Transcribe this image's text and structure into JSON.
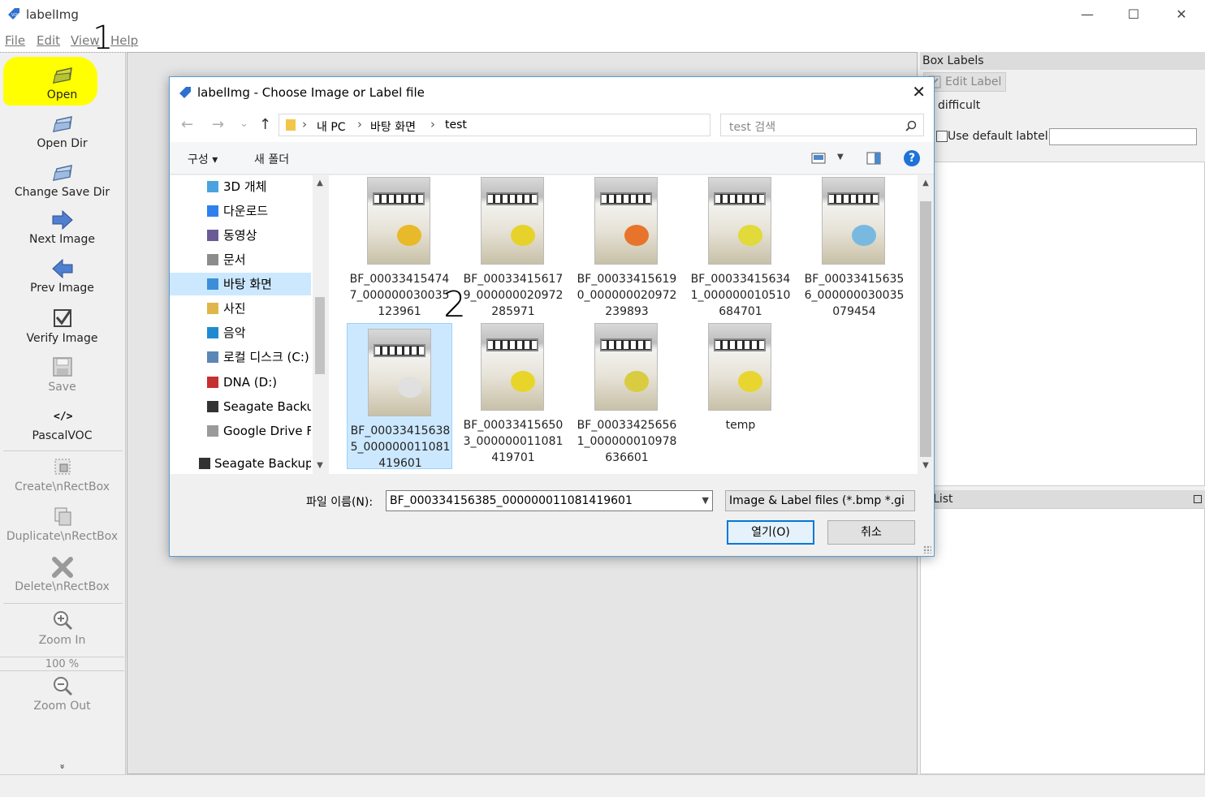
{
  "app": {
    "title": "labelImg",
    "icon": "labelimg-app-icon"
  },
  "window_controls": {
    "minimize": "—",
    "maximize": "☐",
    "close": "✕"
  },
  "menu": [
    {
      "label": "File"
    },
    {
      "label": "Edit"
    },
    {
      "label": "View"
    },
    {
      "label": "Help"
    }
  ],
  "annotations": {
    "step1": "1",
    "step2": "2",
    "highlight_color": "#ffff00"
  },
  "toolbar": {
    "items": [
      {
        "label": "Open",
        "icon": "open-folder-icon",
        "enabled": true
      },
      {
        "label": "Open Dir",
        "icon": "open-dir-icon",
        "enabled": true
      },
      {
        "label": "Change Save Dir",
        "icon": "change-save-dir-icon",
        "enabled": true
      },
      {
        "label": "Next Image",
        "icon": "next-arrow-icon",
        "enabled": true
      },
      {
        "label": "Prev Image",
        "icon": "prev-arrow-icon",
        "enabled": true
      },
      {
        "label": "Verify Image",
        "icon": "verify-check-icon",
        "enabled": true
      },
      {
        "label": "Save",
        "icon": "save-disk-icon",
        "enabled": false
      },
      {
        "label": "PascalVOC",
        "icon": "code-tag-icon",
        "enabled": true
      },
      {
        "label": "Create\\nRectBox",
        "icon": "create-rectbox-icon",
        "enabled": false
      },
      {
        "label": "Duplicate\\nRectBox",
        "icon": "duplicate-rectbox-icon",
        "enabled": false
      },
      {
        "label": "Delete\\nRectBox",
        "icon": "delete-rectbox-icon",
        "enabled": false
      },
      {
        "label": "Zoom In",
        "icon": "zoom-in-icon",
        "enabled": false
      },
      {
        "label": "Zoom Out",
        "icon": "zoom-out-icon",
        "enabled": false
      }
    ],
    "zoom_value": "100 %",
    "expand_glyph": "»"
  },
  "dock": {
    "box_labels_title": "Box Labels",
    "edit_label": "Edit Label",
    "difficult": "difficult",
    "use_default_label": "Use default labtel",
    "default_label_value": "",
    "file_list_title": "e List"
  },
  "dialog": {
    "title": "labelImg - Choose Image or Label file",
    "nav": {
      "back": "←",
      "forward": "→",
      "recent": "⌄",
      "up": "↑"
    },
    "breadcrumb": [
      "내 PC",
      "바탕 화면",
      "test"
    ],
    "refresh_glyph": "↻",
    "search_placeholder": "test 검색",
    "commands": {
      "organize": "구성 ▾",
      "new_folder": "새 폴더"
    },
    "help_glyph": "?",
    "nav_items": [
      {
        "label": "3D 개체",
        "icon": "3d-objects-icon",
        "color": "#4aa3df"
      },
      {
        "label": "다운로드",
        "icon": "downloads-icon",
        "color": "#2f80ed"
      },
      {
        "label": "동영상",
        "icon": "videos-icon",
        "color": "#6b5b95"
      },
      {
        "label": "문서",
        "icon": "documents-icon",
        "color": "#8c8c8c"
      },
      {
        "label": "바탕 화면",
        "icon": "desktop-icon",
        "color": "#3b8fd9",
        "selected": true
      },
      {
        "label": "사진",
        "icon": "pictures-icon",
        "color": "#e0b64a"
      },
      {
        "label": "음악",
        "icon": "music-icon",
        "color": "#1f8ad2"
      },
      {
        "label": "로컬 디스크 (C:)",
        "icon": "local-disk-icon",
        "color": "#5b87b5"
      },
      {
        "label": "DNA (D:)",
        "icon": "usb-drive-icon",
        "color": "#c53030"
      },
      {
        "label": "Seagate Backup",
        "icon": "external-drive-icon",
        "color": "#333333"
      },
      {
        "label": "Google Drive Fil",
        "icon": "google-drive-icon",
        "color": "#9a9a9a"
      },
      {
        "label": "Seagate Backup P",
        "icon": "external-drive-icon",
        "color": "#333333"
      }
    ],
    "files": [
      {
        "name": "BF_000334154747_000000030035123961",
        "sticker": "#e8b928"
      },
      {
        "name": "BF_000334156179_000000020972285971",
        "sticker": "#e7d22c"
      },
      {
        "name": "BF_000334156190_000000020972239893",
        "sticker": "#e8742c"
      },
      {
        "name": "BF_000334156341_000000010510684701",
        "sticker": "#e2d93a"
      },
      {
        "name": "BF_000334156356_000000030035079454",
        "sticker": "#79b9e0"
      },
      {
        "name": "BF_000334156385_000000011081419601",
        "sticker": "#e0e0e0",
        "selected": true
      },
      {
        "name": "BF_000334156503_000000011081419701",
        "sticker": "#e8d52a"
      },
      {
        "name": "BF_000334256561_000000010978636601",
        "sticker": "#d9cc40"
      },
      {
        "name": "temp",
        "sticker": "#e8d530"
      }
    ],
    "filename_label": "파일 이름(N):",
    "filename_value": "BF_000334156385_000000011081419601",
    "filetype_value": "Image & Label files (*.bmp *.gi",
    "open_button": "열기(O)",
    "cancel_button": "취소"
  }
}
